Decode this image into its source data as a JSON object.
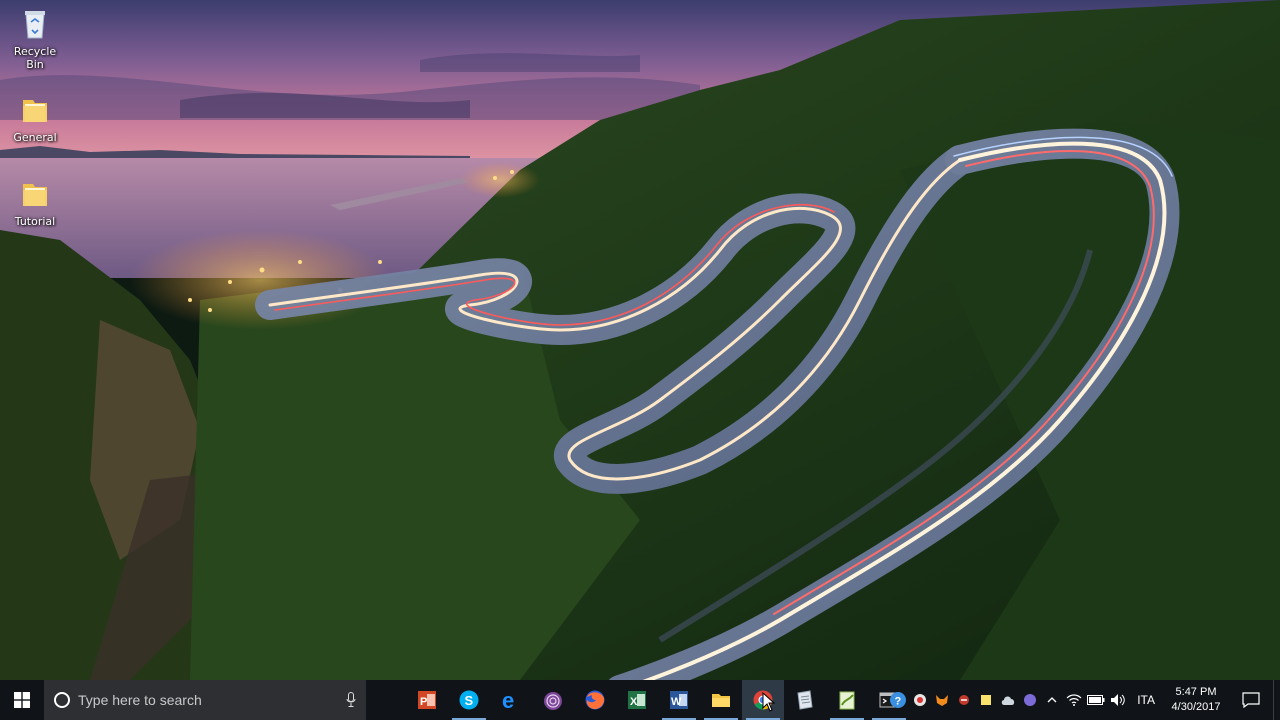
{
  "desktop": {
    "icons": [
      {
        "label": "Recycle Bin",
        "icon": "recycle-bin-icon"
      },
      {
        "label": "General",
        "icon": "folder-icon"
      },
      {
        "label": "Tutorial",
        "icon": "folder-icon"
      }
    ]
  },
  "taskbar": {
    "search_placeholder": "Type here to search",
    "apps": [
      {
        "name": "PowerPoint",
        "icon": "powerpoint-icon",
        "color": "#d24726"
      },
      {
        "name": "Skype",
        "icon": "skype-icon",
        "color": "#00aff0"
      },
      {
        "name": "Edge",
        "icon": "edge-icon",
        "color": "#1e90ff"
      },
      {
        "name": "Tor",
        "icon": "onion-icon",
        "color": "#7d4698"
      },
      {
        "name": "Firefox",
        "icon": "firefox-icon",
        "color": "#ff7139"
      },
      {
        "name": "Excel",
        "icon": "excel-icon",
        "color": "#217346"
      },
      {
        "name": "Word",
        "icon": "word-icon",
        "color": "#2b579a"
      },
      {
        "name": "File Explorer",
        "icon": "folder-icon",
        "color": "#f4c542"
      },
      {
        "name": "Chrome",
        "icon": "chrome-icon",
        "color": "#db4437"
      },
      {
        "name": "Notepad",
        "icon": "notepad-icon",
        "color": "#9aa8b8"
      },
      {
        "name": "Notepad++",
        "icon": "notepadpp-icon",
        "color": "#8fbe4f"
      },
      {
        "name": "Command Prompt",
        "icon": "terminal-icon",
        "color": "#3a3a3a"
      }
    ],
    "tray": {
      "language": "ITA",
      "time": "5:47 PM",
      "date": "4/30/2017"
    }
  }
}
